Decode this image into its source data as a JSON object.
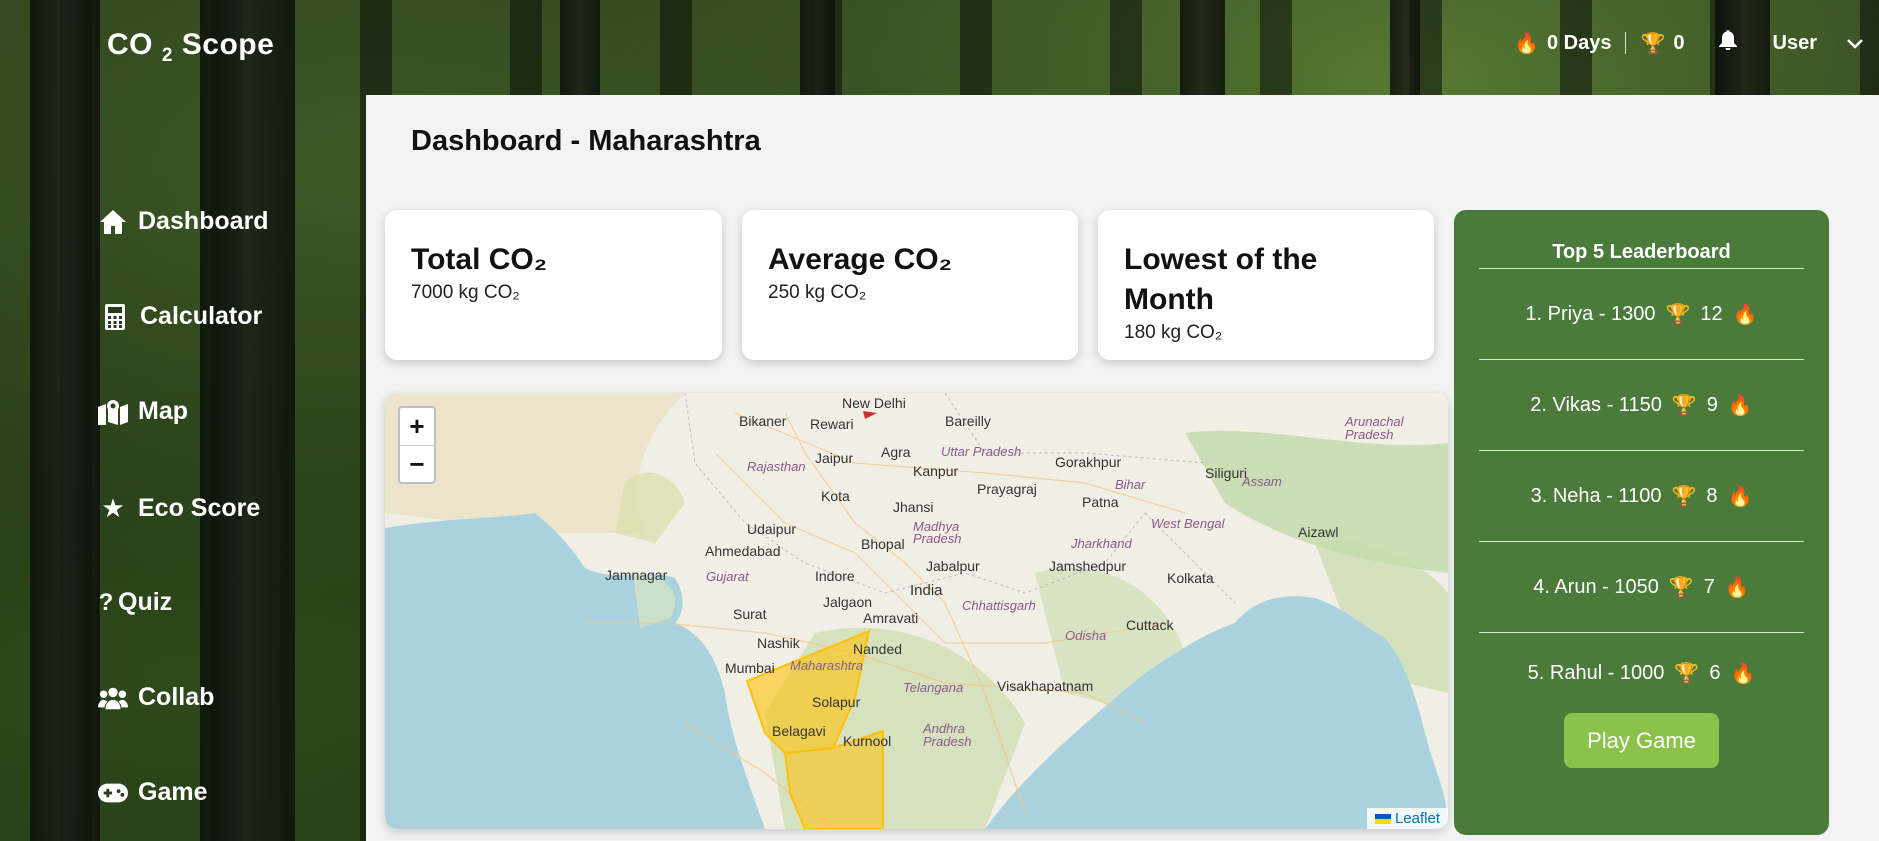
{
  "app": {
    "logo_text": "CO",
    "logo_sub": "2",
    "logo_rest": "Scope"
  },
  "header": {
    "streak_label": "0 Days",
    "trophy_count": "0",
    "user_label": "User",
    "icons": {
      "streak": "flame-icon",
      "trophy": "trophy-icon",
      "notifications": "bell-icon",
      "menu": "chevron-down-icon"
    }
  },
  "sidebar": {
    "items": [
      {
        "label": "Dashboard",
        "icon": "home-icon"
      },
      {
        "label": "Calculator",
        "icon": "calculator-icon"
      },
      {
        "label": "Map",
        "icon": "map-marker-icon"
      },
      {
        "label": "Eco Score",
        "icon": "star-icon"
      },
      {
        "label": "Quiz",
        "icon": "question-icon"
      },
      {
        "label": "Collab",
        "icon": "users-icon"
      },
      {
        "label": "Game",
        "icon": "gamepad-icon"
      }
    ]
  },
  "main": {
    "title": "Dashboard - Maharashtra",
    "cards": [
      {
        "title": "Total CO₂",
        "value": "7000 kg CO₂"
      },
      {
        "title": "Average CO₂",
        "value": "250 kg CO₂"
      },
      {
        "title": "Lowest of the Month",
        "value": "180 kg CO₂"
      }
    ]
  },
  "map": {
    "zoom_in": "+",
    "zoom_out": "−",
    "attribution": "Leaflet",
    "highlight_color": "#ffc107",
    "labels": {
      "new_delhi": "New Delhi",
      "bikaner": "Bikaner",
      "rewari": "Rewari",
      "bareilly": "Bareilly",
      "jaipur": "Jaipur",
      "agra": "Agra",
      "uttar_pradesh": "Uttar Pradesh",
      "gorakhpur": "Gorakhpur",
      "siliguri": "Siliguri",
      "rajasthan": "Rajasthan",
      "kanpur": "Kanpur",
      "prayagraj": "Prayagraj",
      "patna": "Patna",
      "bihar": "Bihar",
      "kota": "Kota",
      "jhansi": "Jhansi",
      "assam": "Assam",
      "udaipur": "Udaipur",
      "madhya_pradesh": "Madhya Pradesh",
      "jharkhand": "Jharkhand",
      "west_bengal": "West Bengal",
      "aizawl": "Aizawl",
      "bhopal": "Bhopal",
      "ahmedabad": "Ahmedabad",
      "jamshedpur": "Jamshedpur",
      "jamnagar": "Jamnagar",
      "gujarat": "Gujarat",
      "indore": "Indore",
      "jabalpur": "Jabalpur",
      "kolkata": "Kolkata",
      "india": "India",
      "jalgaon": "Jalgaon",
      "chhattisgarh": "Chhattisgarh",
      "surat": "Surat",
      "amravati": "Amravati",
      "cuttack": "Cuttack",
      "nashik": "Nashik",
      "nanded": "Nanded",
      "odisha": "Odisha",
      "mumbai": "Mumbai",
      "maharashtra": "Maharashtra",
      "telangana": "Telangana",
      "visakhapatnam": "Visakhapatnam",
      "solapur": "Solapur",
      "belagavi": "Belagavi",
      "kurnool": "Kurnool",
      "andhra_pradesh": "Andhra Pradesh",
      "arunachal_pradesh": "Arunachal Pradesh"
    }
  },
  "leaderboard": {
    "title": "Top 5 Leaderboard",
    "rows": [
      {
        "text": "1. Priya - 1300",
        "streak": "12"
      },
      {
        "text": "2. Vikas - 1150",
        "streak": "9"
      },
      {
        "text": "3. Neha - 1100",
        "streak": "8"
      },
      {
        "text": "4. Arun - 1050",
        "streak": "7"
      },
      {
        "text": "5. Rahul - 1000",
        "streak": "6"
      }
    ],
    "play_button": "Play Game"
  }
}
